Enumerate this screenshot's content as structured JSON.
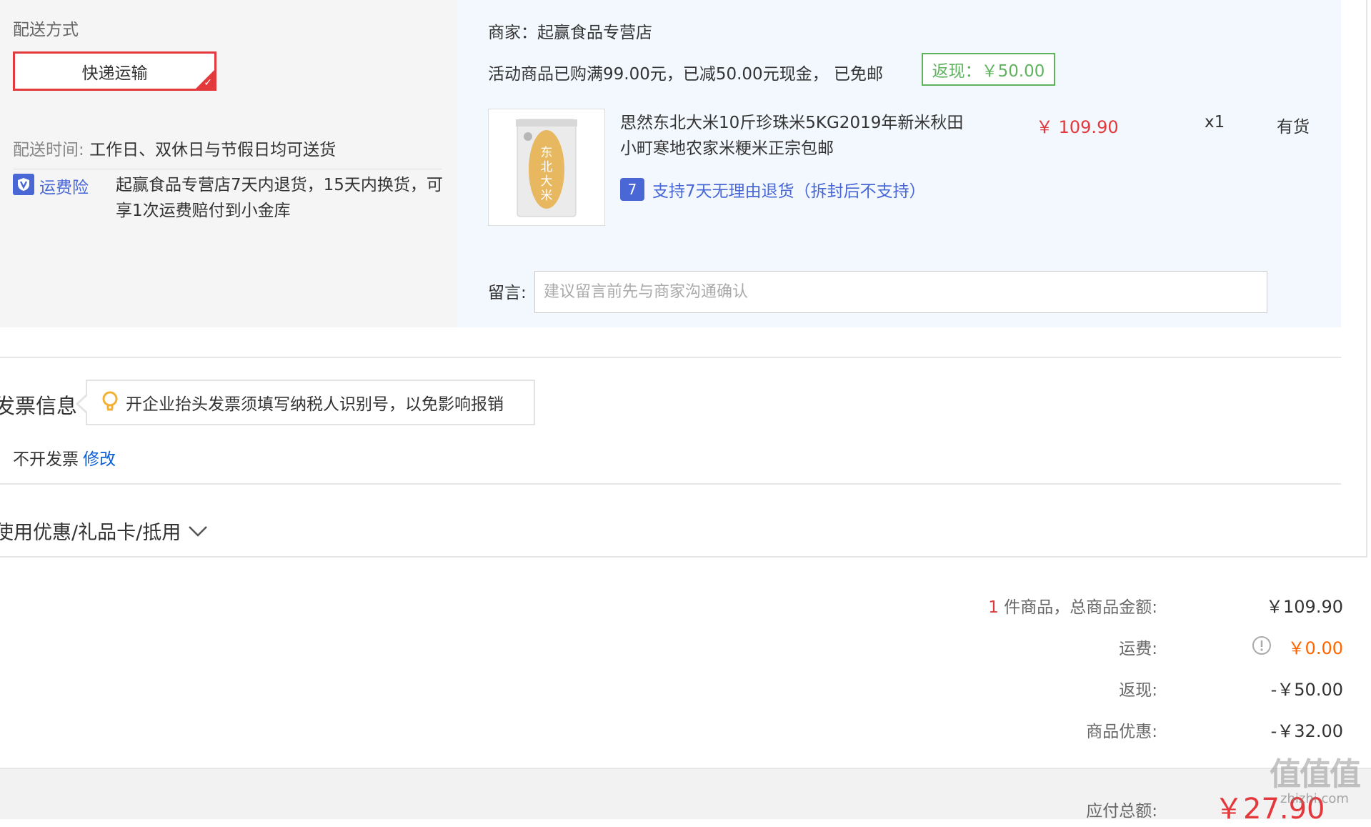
{
  "delivery": {
    "section_label": "配送方式",
    "method": "快递运输",
    "time_label": "配送时间:",
    "time_value": "工作日、双休日与节假日均可送货",
    "insurance_label": "运费险",
    "insurance_desc": "起赢食品专营店7天内退货，15天内换货，可享1次运费赔付到小金库"
  },
  "shop": {
    "seller": "商家：起赢食品专营店",
    "promo": "活动商品已购满99.00元，已减50.00元现金， 已免邮",
    "cashback_badge": "返现：￥50.00",
    "product": {
      "title": "思然东北大米10斤珍珠米5KG2019年新米秋田小町寒地农家米粳米正宗包邮",
      "price": "￥ 109.90",
      "quantity": "x1",
      "stock": "有货",
      "image_text": "东北大米",
      "return_policy": "支持7天无理由退货（拆封后不支持）"
    },
    "message_label": "留言:",
    "message_placeholder": "建议留言前先与商家沟通确认"
  },
  "invoice": {
    "title": "发票信息",
    "tip": "开企业抬头发票须填写纳税人识别号，以免影响报销",
    "status": "不开发票",
    "edit_link": "修改"
  },
  "coupon": {
    "label": "使用优惠/礼品卡/抵用"
  },
  "summary": {
    "item_count": "1",
    "items_label": "件商品，总商品金额:",
    "items_value": "￥109.90",
    "shipping_label": "运费:",
    "shipping_value": "￥0.00",
    "cashback_label": "返现:",
    "cashback_value": "-￥50.00",
    "discount_label": "商品优惠:",
    "discount_value": "-￥32.00",
    "total_label": "应付总额:",
    "total_value": "￥27.90"
  },
  "watermark": {
    "brand": "值值值",
    "site": "zhizhi.com"
  },
  "colors": {
    "accent_red": "#e4393c",
    "link_blue": "#4a67d6",
    "cashback_green": "#5fb35f",
    "shipping_orange": "#ff6600"
  }
}
